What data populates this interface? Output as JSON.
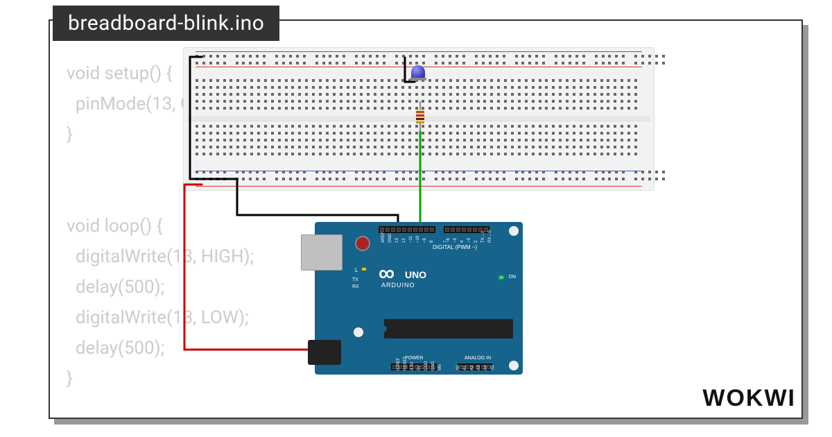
{
  "title": "breadboard-blink.ino",
  "logo": "WOKWI",
  "code": "void setup() {\n  pinMode(13, OUTPUT);\n}\n\n\nvoid loop() {\n  digitalWrite(13, HIGH);\n  delay(500);\n  digitalWrite(13, LOW);\n  delay(500);\n}",
  "arduino": {
    "board_label": "UNO",
    "brand": "ARDUINO",
    "digital_label": "DIGITAL (PWM ~)",
    "power_label": "POWER",
    "analog_label": "ANALOG IN",
    "on_label": "ON",
    "tx_label": "TX",
    "rx_label": "RX",
    "l_label": "L",
    "digital_pins": [
      "AREF",
      "GND",
      "13",
      "12",
      "~11",
      "~10",
      "~9",
      "8",
      "",
      "7",
      "~6",
      "~5",
      "4",
      "~3",
      "2",
      "TX→1",
      "RX←0"
    ],
    "power_pins": [
      "",
      "IOREF",
      "RESET",
      "3.3V",
      "5V",
      "GND",
      "GND",
      "Vin"
    ],
    "analog_pins": [
      "A0",
      "A1",
      "A2",
      "A3",
      "A4",
      "A5"
    ]
  },
  "components": {
    "breadboard": "breadboard",
    "led": "led-blue",
    "resistor": "resistor-220"
  },
  "wires": [
    {
      "color": "#c00",
      "from": "arduino-5v",
      "to": "breadboard-power-plus"
    },
    {
      "color": "#000",
      "from": "arduino-gnd",
      "to": "breadboard-power-minus"
    },
    {
      "color": "#0a0",
      "from": "arduino-d13",
      "to": "resistor-leg"
    },
    {
      "color": "#000",
      "from": "led-cathode",
      "to": "breadboard-gnd-rail"
    }
  ]
}
